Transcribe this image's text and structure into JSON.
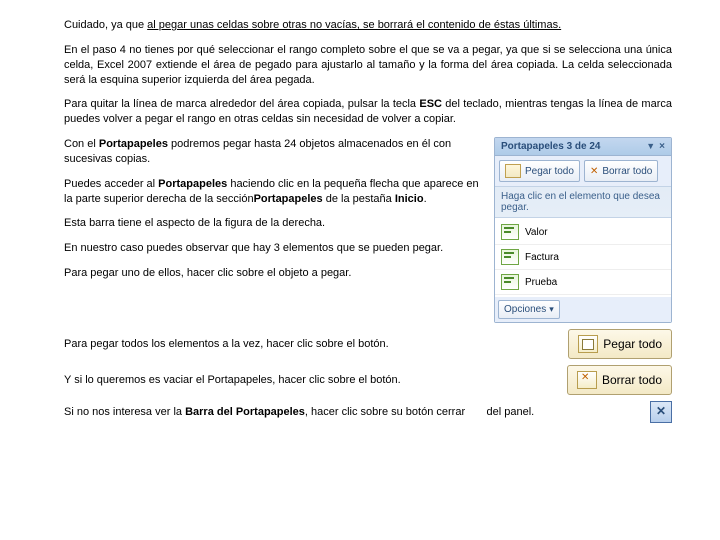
{
  "p1": {
    "a": "Cuidado, ya que ",
    "b": "al pegar unas celdas sobre otras no vacías, se borrará el contenido de éstas últimas."
  },
  "p2": "En el paso 4 no tienes por qué seleccionar el rango completo sobre el que se va a pegar, ya que si se selecciona una única celda, Excel 2007 extiende el área de pegado para ajustarlo al tamaño y la forma del área copiada. La celda seleccionada será la esquina superior izquierda del área pegada.",
  "p3": {
    "a": "Para quitar la línea de marca alrededor del área copiada, pulsar la tecla ",
    "b": "ESC",
    "c": " del teclado, mientras tengas la línea de marca puedes volver a pegar el rango en otras celdas sin necesidad de volver a copiar."
  },
  "left": {
    "l1a": "Con el ",
    "l1b": "Portapapeles",
    "l1c": " podremos pegar hasta 24 objetos almacenados en él con sucesivas copias.",
    "l2a": "Puedes acceder al ",
    "l2b": "Portapapeles",
    "l2c": " haciendo clic en la pequeña flecha que aparece en la parte superior derecha de la sección",
    "l2d": "Portapapeles",
    "l2e": " de la pestaña ",
    "l2f": "Inicio",
    "l2g": ".",
    "l3": "Esta barra tiene el aspecto de la figura de la derecha.",
    "l4": "En nuestro caso puedes observar que hay 3 elementos que se pueden pegar.",
    "l5": "Para pegar uno de ellos, hacer clic sobre el objeto a pegar."
  },
  "r1": "Para pegar todos los elementos a la vez, hacer clic sobre el botón.",
  "r2": "Y si lo queremos es vaciar el Portapapeles, hacer clic sobre el botón.",
  "r3": {
    "a": "Si no nos interesa ver la ",
    "b": "Barra del Portapapeles",
    "c": ", hacer clic sobre su botón cerrar",
    "d": "del panel."
  },
  "panel": {
    "title": "Portapapeles 3 de 24",
    "pasteAll": "Pegar todo",
    "clearAll": "Borrar todo",
    "hint": "Haga clic en el elemento que desea pegar.",
    "items": [
      "Valor",
      "Factura",
      "Prueba"
    ],
    "options": "Opciones"
  },
  "btnPaste": "Pegar todo",
  "btnClear": "Borrar todo",
  "close": "✕"
}
